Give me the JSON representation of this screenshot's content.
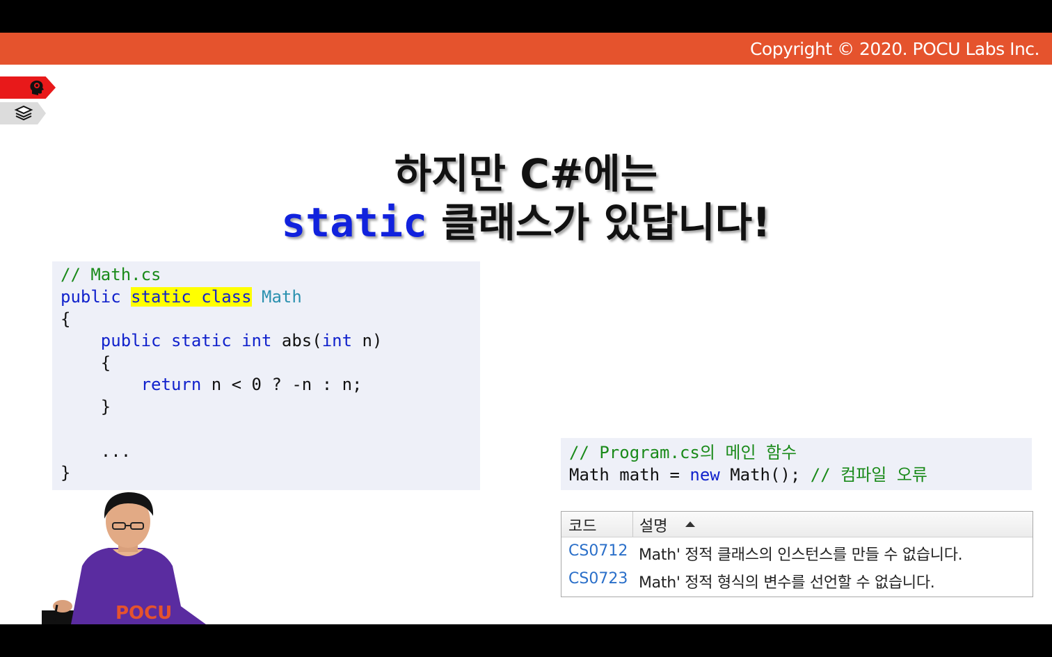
{
  "header": {
    "copyright": "Copyright © 2020. POCU Labs Inc."
  },
  "sidebar": {
    "tabs": [
      {
        "icon": "brain-head-icon"
      },
      {
        "icon": "books-stack-icon"
      }
    ]
  },
  "title": {
    "line1": "하지만 C#에는",
    "line2_keyword": "static",
    "line2_rest": " 클래스가 있답니다!"
  },
  "code_math": {
    "l1": "// Math.cs",
    "l2_public": "public ",
    "l2_hl": "static class",
    "l2_sp": " ",
    "l2_type": "Math",
    "l3": "{",
    "l4_indent": "    ",
    "l4_kw": "public static int",
    "l4_mid": " abs(",
    "l4_kw2": "int",
    "l4_end": " n)",
    "l5": "    {",
    "l6_indent": "        ",
    "l6_kw": "return",
    "l6_rest": " n < 0 ? -n : n;",
    "l7": "    }",
    "l8": "",
    "l9": "    ...",
    "l10": "}"
  },
  "code_program": {
    "l1": "// Program.cs의 메인 함수",
    "l2_a": "Math math = ",
    "l2_kw": "new",
    "l2_b": " Math(); ",
    "l2_com": "// 컴파일 오류"
  },
  "error_list": {
    "col_code": "코드",
    "col_desc": "설명",
    "sort_icon": "sort-ascending-icon",
    "rows": [
      {
        "code": "CS0712",
        "desc": "Math' 정적 클래스의 인스턴스를 만들 수 없습니다."
      },
      {
        "code": "CS0723",
        "desc": "Math' 정적 형식의 변수를 선언할 수 없습니다."
      }
    ]
  },
  "presenter": {
    "shirt_text": "POCU"
  }
}
